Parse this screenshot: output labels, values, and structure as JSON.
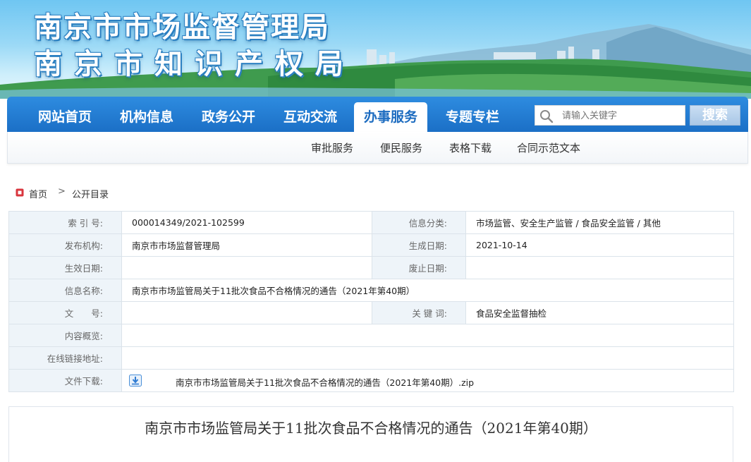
{
  "banner": {
    "title_line1": "南京市市场监督管理局",
    "title_line2": "南京市知识产权局"
  },
  "nav": {
    "items": [
      {
        "label": "网站首页"
      },
      {
        "label": "机构信息"
      },
      {
        "label": "政务公开"
      },
      {
        "label": "互动交流"
      },
      {
        "label": "办事服务"
      },
      {
        "label": "专题专栏"
      }
    ],
    "active_item": "办事服务",
    "search_placeholder": "请输入关键字",
    "search_button": "搜索"
  },
  "subnav": {
    "items": [
      {
        "label": "审批服务"
      },
      {
        "label": "便民服务"
      },
      {
        "label": "表格下载"
      },
      {
        "label": "合同示范文本"
      }
    ]
  },
  "breadcrumb": {
    "home": "首页",
    "separator": ">",
    "current": "公开目录"
  },
  "info": {
    "index_label": "索 引 号:",
    "index_value": "000014349/2021-102599",
    "category_label": "信息分类:",
    "category_value": "市场监管、安全生产监管 / 食品安全监管 / 其他",
    "publisher_label": "发布机构:",
    "publisher_value": "南京市市场监督管理局",
    "created_label": "生成日期:",
    "created_value": "2021-10-14",
    "effective_label": "生效日期:",
    "effective_value": "",
    "expire_label": "废止日期:",
    "expire_value": "",
    "name_label": "信息名称:",
    "name_value": "南京市市场监管局关于11批次食品不合格情况的通告（2021年第40期）",
    "docno_label": "文　　号:",
    "docno_value": "",
    "keywords_label": "关 键 词:",
    "keywords_value": "食品安全监督抽检",
    "summary_label": "内容概览:",
    "summary_value": "",
    "link_label": "在线链接地址:",
    "link_value": "",
    "download_label": "文件下载:",
    "download_file": "南京市市场监管局关于11批次食品不合格情况的通告（2021年第40期）.zip"
  },
  "article": {
    "title": "南京市市场监管局关于11批次食品不合格情况的通告（2021年第40期）"
  },
  "colors": {
    "nav_blue": "#1b6fc6",
    "label_bg": "#eef4f9",
    "search_button": "#a9c7e6"
  }
}
